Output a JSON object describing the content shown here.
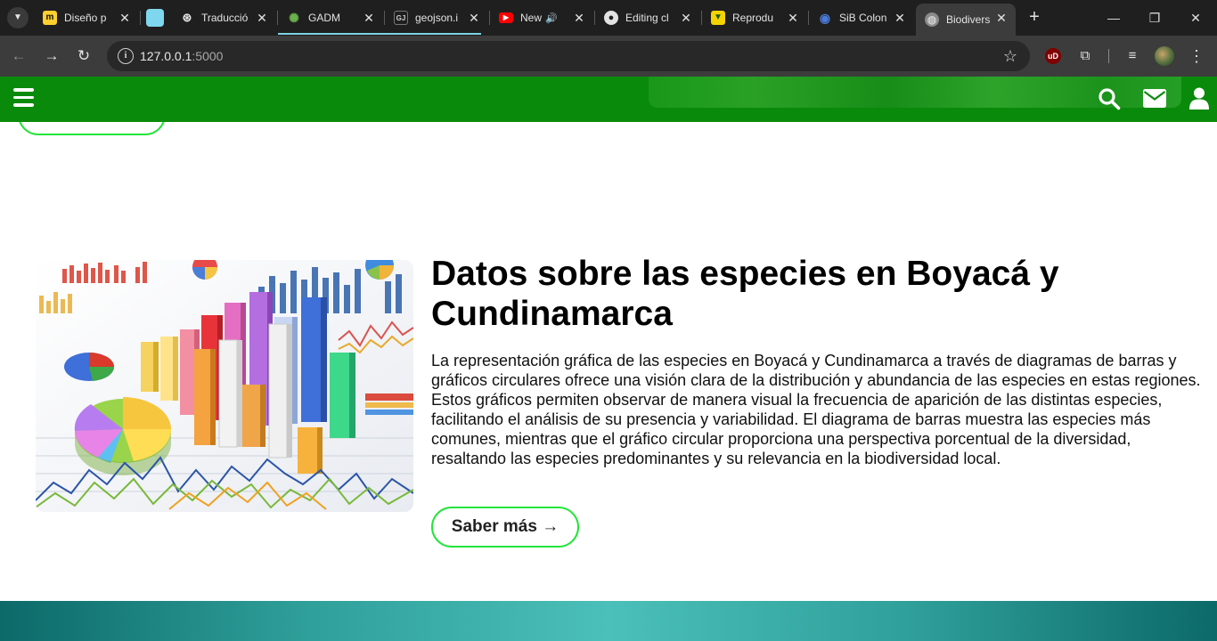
{
  "browser": {
    "tabs": [
      {
        "title": "Diseño p",
        "favicon": "miro-icon",
        "fav_color": "#ffd02f",
        "fav_text": "m"
      },
      {
        "title": "",
        "favicon": "app-icon",
        "fav_color": "#7fd7ef",
        "fav_text": ""
      },
      {
        "title": "Traducció",
        "favicon": "openai-icon",
        "fav_color": "#1f1f1f",
        "fav_text": "⊛"
      },
      {
        "title": "GADM",
        "favicon": "gadm-icon",
        "fav_color": "#1f1f1f",
        "fav_text": "✺"
      },
      {
        "title": "geojson.i",
        "favicon": "geojson-icon",
        "fav_color": "#2a2a2a",
        "fav_text": "GJ"
      },
      {
        "title": "New",
        "favicon": "youtube-icon",
        "fav_color": "#ff0000",
        "fav_text": "▶"
      },
      {
        "title": "Editing cl",
        "favicon": "github-icon",
        "fav_color": "#1f1f1f",
        "fav_text": "●"
      },
      {
        "title": "Reprodu",
        "favicon": "shield-icon",
        "fav_color": "#f5d300",
        "fav_text": "▼"
      },
      {
        "title": "SiB Colon",
        "favicon": "sib-icon",
        "fav_color": "#1f1f1f",
        "fav_text": "◉"
      },
      {
        "title": "Biodivers",
        "favicon": "globe-icon",
        "fav_color": "#9a9a9a",
        "fav_text": "◍"
      }
    ],
    "address": {
      "host": "127.0.0.1",
      "port": ":5000"
    }
  },
  "page": {
    "ghost_button_label": "Saber más →",
    "colors": {
      "header_green": "#0a8a0a",
      "button_border": "#23e43a",
      "footer_teal": "#2f9f9a"
    },
    "header": {
      "menu_icon": "hamburger-icon",
      "search_icon": "search-icon",
      "mail_icon": "mail-icon",
      "user_icon": "user-icon"
    },
    "feature": {
      "title": "Datos sobre las especies en Boyacá y Cundinamarca",
      "paragraph": "La representación gráfica de las especies en Boyacá y Cundinamarca a través de diagramas de barras y gráficos circulares ofrece una visión clara de la distribución y abundancia de las especies en estas regiones. Estos gráficos permiten observar de manera visual la frecuencia de aparición de las distintas especies, facilitando el análisis de su presencia y variabilidad. El diagrama de barras muestra las especies más comunes, mientras que el gráfico circular proporciona una perspectiva porcentual de la diversidad, resaltando las especies predominantes y su relevancia en la biodiversidad local.",
      "button_label": "Saber más →"
    }
  }
}
